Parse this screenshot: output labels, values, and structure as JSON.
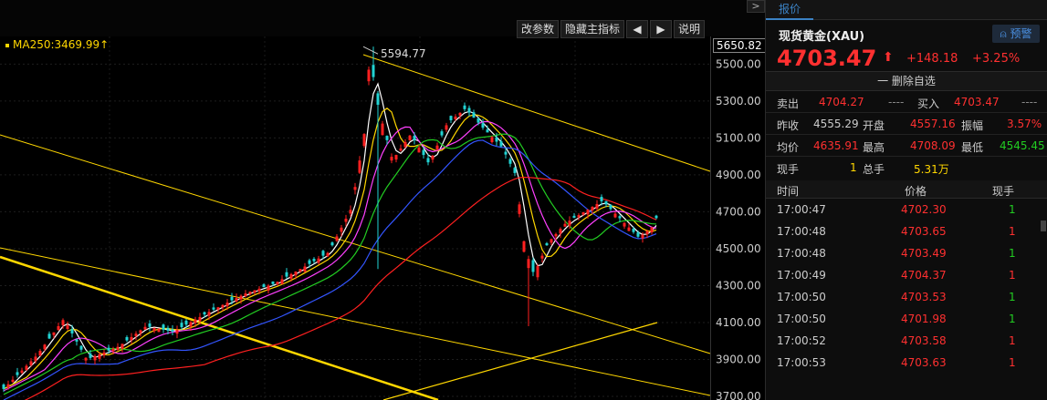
{
  "chart_data": {
    "type": "candlestick",
    "y_ticks": [
      "5500.00",
      "5300.00",
      "5100.00",
      "4900.00",
      "4700.00",
      "4500.00",
      "4300.00",
      "4100.00",
      "3900.00",
      "3700.00"
    ],
    "ylim": [
      3690,
      5660
    ],
    "current_price_tag": "5650.82",
    "high_annotation": "5594.77",
    "ma_label": "MA250:3469.99",
    "ma_arrow": "↑",
    "up_color": "#ff2020",
    "down_color": "#22d3d3"
  },
  "toolbar": {
    "change_params": "改参数",
    "hide_main_indicator": "隐藏主指标",
    "prev_arrow": "🡄",
    "next_arrow": "🡆",
    "help": "说明",
    "collapse": ">"
  },
  "panel": {
    "tab": "报价",
    "symbol": "现货黄金(XAU)",
    "alert_button": "预警",
    "last_price": "4703.47",
    "arrow": "⬆",
    "change": "+148.18",
    "change_pct": "+3.25%",
    "remove_watchlist": "一 删除自选",
    "sell_label": "卖出",
    "sell_value": "4704.27",
    "sell_qty": "----",
    "buy_label": "买入",
    "buy_value": "4703.47",
    "buy_qty": "----",
    "prev_close_label": "昨收",
    "prev_close": "4555.29",
    "open_label": "开盘",
    "open": "4557.16",
    "amplitude_label": "振幅",
    "amplitude": "3.57%",
    "avg_label": "均价",
    "avg": "4635.91",
    "high_label": "最高",
    "high": "4708.09",
    "low_label": "最低",
    "low": "4545.45",
    "cur_vol_label": "现手",
    "cur_vol": "1",
    "total_vol_label": "总手",
    "total_vol": "5.31万",
    "trades_header": {
      "time": "时间",
      "price": "价格",
      "vol": "现手"
    },
    "trades": [
      {
        "time": "17:00:47",
        "price": "4702.30",
        "vol": "1",
        "vol_color": "green"
      },
      {
        "time": "17:00:48",
        "price": "4703.65",
        "vol": "1",
        "vol_color": "red"
      },
      {
        "time": "17:00:48",
        "price": "4703.49",
        "vol": "1",
        "vol_color": "green"
      },
      {
        "time": "17:00:49",
        "price": "4704.37",
        "vol": "1",
        "vol_color": "red"
      },
      {
        "time": "17:00:50",
        "price": "4703.53",
        "vol": "1",
        "vol_color": "green"
      },
      {
        "time": "17:00:50",
        "price": "4701.98",
        "vol": "1",
        "vol_color": "green"
      },
      {
        "time": "17:00:52",
        "price": "4703.58",
        "vol": "1",
        "vol_color": "red"
      },
      {
        "time": "17:00:53",
        "price": "4703.63",
        "vol": "1",
        "vol_color": "red"
      }
    ]
  }
}
